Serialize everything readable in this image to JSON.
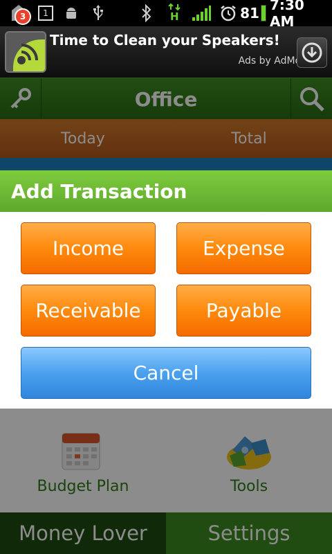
{
  "status_bar": {
    "notification_count": "3",
    "sim_label": "1",
    "network_label": "H",
    "battery": "81",
    "time": "7:30 AM",
    "icons": [
      "notification-icon",
      "sim-icon",
      "android-icon",
      "usb-icon",
      "bluetooth-icon",
      "data-icon",
      "signal-icon",
      "alarm-icon",
      "battery-icon"
    ]
  },
  "ad": {
    "title": "Time to Clean your Speakers!",
    "subtitle": "Ads by AdMob"
  },
  "app_header": {
    "title": "Office"
  },
  "summary": {
    "today_label": "Today",
    "total_label": "Total"
  },
  "dialog": {
    "title": "Add Transaction",
    "buttons": {
      "income": "Income",
      "expense": "Expense",
      "receivable": "Receivable",
      "payable": "Payable",
      "cancel": "Cancel"
    }
  },
  "content": {
    "budget_plan": "Budget Plan",
    "tools": "Tools"
  },
  "bottom_tabs": {
    "money_lover": "Money Lover",
    "settings": "Settings"
  },
  "colors": {
    "accent_green": "#5ea82b",
    "orange": "#ff8a0c",
    "blue": "#4ba1ee"
  }
}
